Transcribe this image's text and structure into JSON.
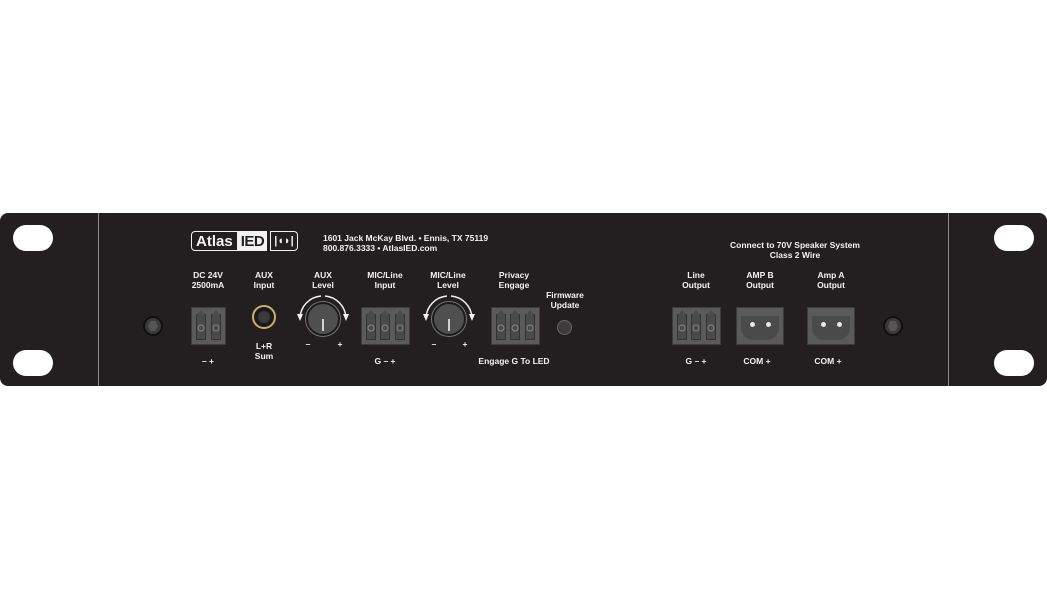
{
  "brand": {
    "logo_text_a": "Atlas",
    "logo_text_b": "IED",
    "logo_mark": "|◖◗|",
    "address_line1": "1601 Jack McKay Blvd. • Ennis, TX 75119",
    "address_line2": "800.876.3333 • AtlasIED.com"
  },
  "colors": {
    "panel": "#231f20",
    "text": "#f2f2f2",
    "terminal": "#5a5a5a",
    "jack_ring": "#c9b36a"
  },
  "speaker_note": {
    "line1": "Connect to 70V Speaker System",
    "line2": "Class 2 Wire"
  },
  "connectors": [
    {
      "id": "dc",
      "label1": "DC 24V",
      "label2": "2500mA",
      "pins": "–  +"
    },
    {
      "id": "aux-input",
      "label1": "AUX",
      "label2": "Input",
      "below1": "L+R",
      "below2": "Sum"
    },
    {
      "id": "aux-level",
      "label1": "AUX",
      "label2": "Level",
      "minus": "–",
      "plus": "+"
    },
    {
      "id": "mic-input",
      "label1": "MIC/Line",
      "label2": "Input",
      "pins": "G  –  +"
    },
    {
      "id": "mic-level",
      "label1": "MIC/Line",
      "label2": "Level",
      "minus": "–",
      "plus": "+"
    },
    {
      "id": "privacy",
      "label1": "Privacy",
      "label2": "Engage",
      "pins": "Engage  G  To LED"
    },
    {
      "id": "firmware",
      "label1": "Firmware",
      "label2": "Update"
    },
    {
      "id": "line-output",
      "label1": "Line",
      "label2": "Output",
      "pins": "G  –  +"
    },
    {
      "id": "amp-b",
      "label1": "AMP B",
      "label2": "Output",
      "pins": "COM  +"
    },
    {
      "id": "amp-a",
      "label1": "Amp A",
      "label2": "Output",
      "pins": "COM  +"
    }
  ]
}
